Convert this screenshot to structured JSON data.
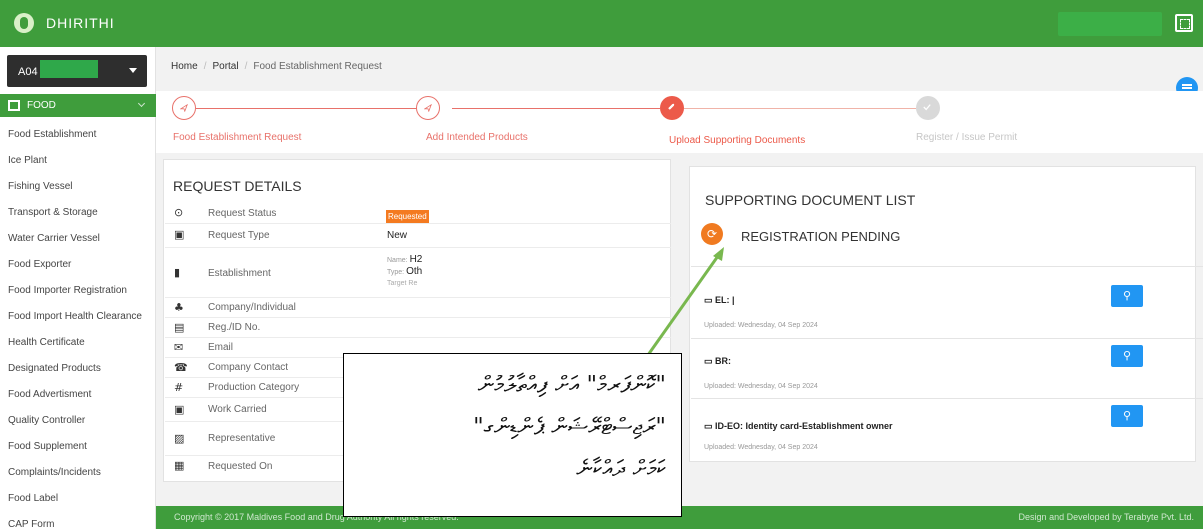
{
  "app": {
    "brand": "DHIRITHI",
    "account": "A04",
    "colors": {
      "primary": "#3f9d3c",
      "accent": "#f47a20",
      "info": "#2196f3",
      "muted": "#c6c6c6"
    }
  },
  "sidebar": {
    "section": "FOOD",
    "items": [
      "Food Establishment",
      "Ice Plant",
      "Fishing Vessel",
      "Transport & Storage",
      "Water Carrier Vessel",
      "Food Exporter",
      "Food Importer Registration",
      "Food Import Health Clearance",
      "Health Certificate",
      "Designated Products",
      "Food Advertisment",
      "Quality Controller",
      "Food Supplement",
      "Complaints/Incidents",
      "Food Label",
      "CAP Form"
    ]
  },
  "breadcrumb": {
    "home": "Home",
    "portal": "Portal",
    "current": "Food Establishment Request"
  },
  "steps": [
    {
      "label": "Food Establishment Request",
      "state": "done"
    },
    {
      "label": "Add Intended Products",
      "state": "done"
    },
    {
      "label": "Upload Supporting Documents",
      "state": "active"
    },
    {
      "label": "Register / Issue Permit",
      "state": "pending"
    }
  ],
  "request_details": {
    "title": "REQUEST DETAILS",
    "rows": [
      {
        "icon": "clock-icon",
        "label": "Request Status",
        "value": "Requested"
      },
      {
        "icon": "calendar-icon",
        "label": "Request Type",
        "value": "New"
      },
      {
        "icon": "building-icon",
        "label": "Establishment",
        "name_label": "Name:",
        "name_value": "H2",
        "type_label": "Type:",
        "type_value": "Oth",
        "target_label": "Target Re"
      },
      {
        "icon": "sitemap-icon",
        "label": "Company/Individual"
      },
      {
        "icon": "id-card-icon",
        "label": "Reg./ID No."
      },
      {
        "icon": "envelope-icon",
        "label": "Email"
      },
      {
        "icon": "phone-icon",
        "label": "Company Contact"
      },
      {
        "icon": "hash-icon",
        "label": "Production Category"
      },
      {
        "icon": "calendar-icon",
        "label": "Work Carried"
      },
      {
        "icon": "image-icon",
        "label": "Representative"
      },
      {
        "icon": "calendar-grid-icon",
        "label": "Requested On"
      }
    ]
  },
  "documents": {
    "title": "SUPPORTING DOCUMENT LIST",
    "status": "REGISTRATION PENDING",
    "items": [
      {
        "code": "EL: |",
        "uploaded": "Uploaded: Wednesday, 04 Sep 2024"
      },
      {
        "code": "BR:",
        "uploaded": "Uploaded: Wednesday, 04 Sep 2024"
      },
      {
        "code": "ID-EO: Identity card-Establishment owner",
        "uploaded": "Uploaded: Wednesday, 04 Sep 2024"
      }
    ]
  },
  "footer": {
    "copyright": "Copyright © 2017 Maldives Food and Drug Authority All rights reserved.",
    "credit": "Design and Developed by Terabyte Pvt. Ltd."
  },
  "annotation": {
    "text": "\"ކޮންފަރމް\" އަށް ފިއްތާލުމުން\n\"ރަޖިސްޓްރޭޝަން ޕެންޑިންގ\"\nކަމަށް ދައްކާނެ"
  }
}
